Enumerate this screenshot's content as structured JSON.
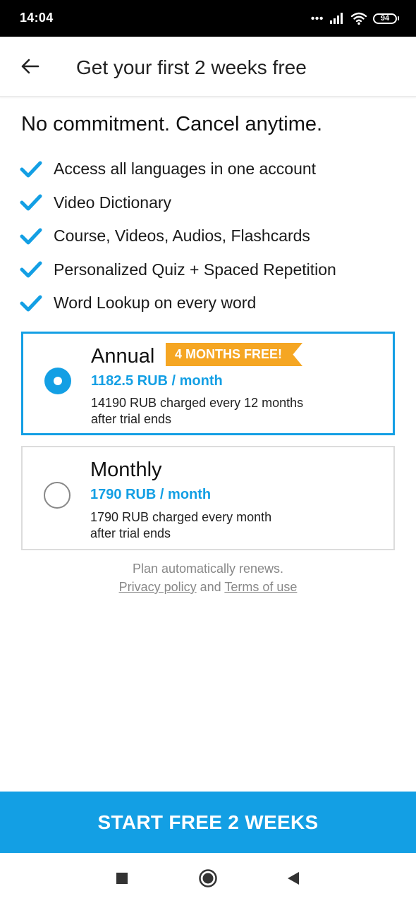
{
  "status_bar": {
    "time": "14:04",
    "battery": "94",
    "icons": [
      "more-dots-icon",
      "signal-icon",
      "wifi-icon",
      "battery-icon"
    ]
  },
  "app_bar": {
    "title": "Get your first 2 weeks free",
    "back_icon": "arrow-left-icon"
  },
  "headline": "No commitment. Cancel anytime.",
  "features": [
    "Access all languages in one account",
    "Video Dictionary",
    "Course, Videos, Audios, Flashcards",
    "Personalized Quiz + Spaced Repetition",
    "Word Lookup on every word"
  ],
  "plans": [
    {
      "name": "Annual",
      "badge": "4 MONTHS FREE!",
      "price": "1182.5 RUB / month",
      "note_line1": "14190 RUB charged every 12 months",
      "note_line2": "after trial ends",
      "selected": true
    },
    {
      "name": "Monthly",
      "price": "1790 RUB / month",
      "note_line1": "1790 RUB charged every month",
      "note_line2": "after trial ends",
      "selected": false
    }
  ],
  "footer": {
    "renew_text": "Plan automatically renews.",
    "privacy_link": "Privacy policy",
    "and_text": "and",
    "terms_link": "Terms of use"
  },
  "cta_label": "START FREE 2 WEEKS",
  "nav_bar": {
    "icons": [
      "recents-square-icon",
      "home-circle-icon",
      "back-triangle-icon"
    ]
  },
  "colors": {
    "accent": "#139fe4",
    "badge": "#f5a623",
    "check": "#139fe4",
    "muted_text": "#888888"
  }
}
